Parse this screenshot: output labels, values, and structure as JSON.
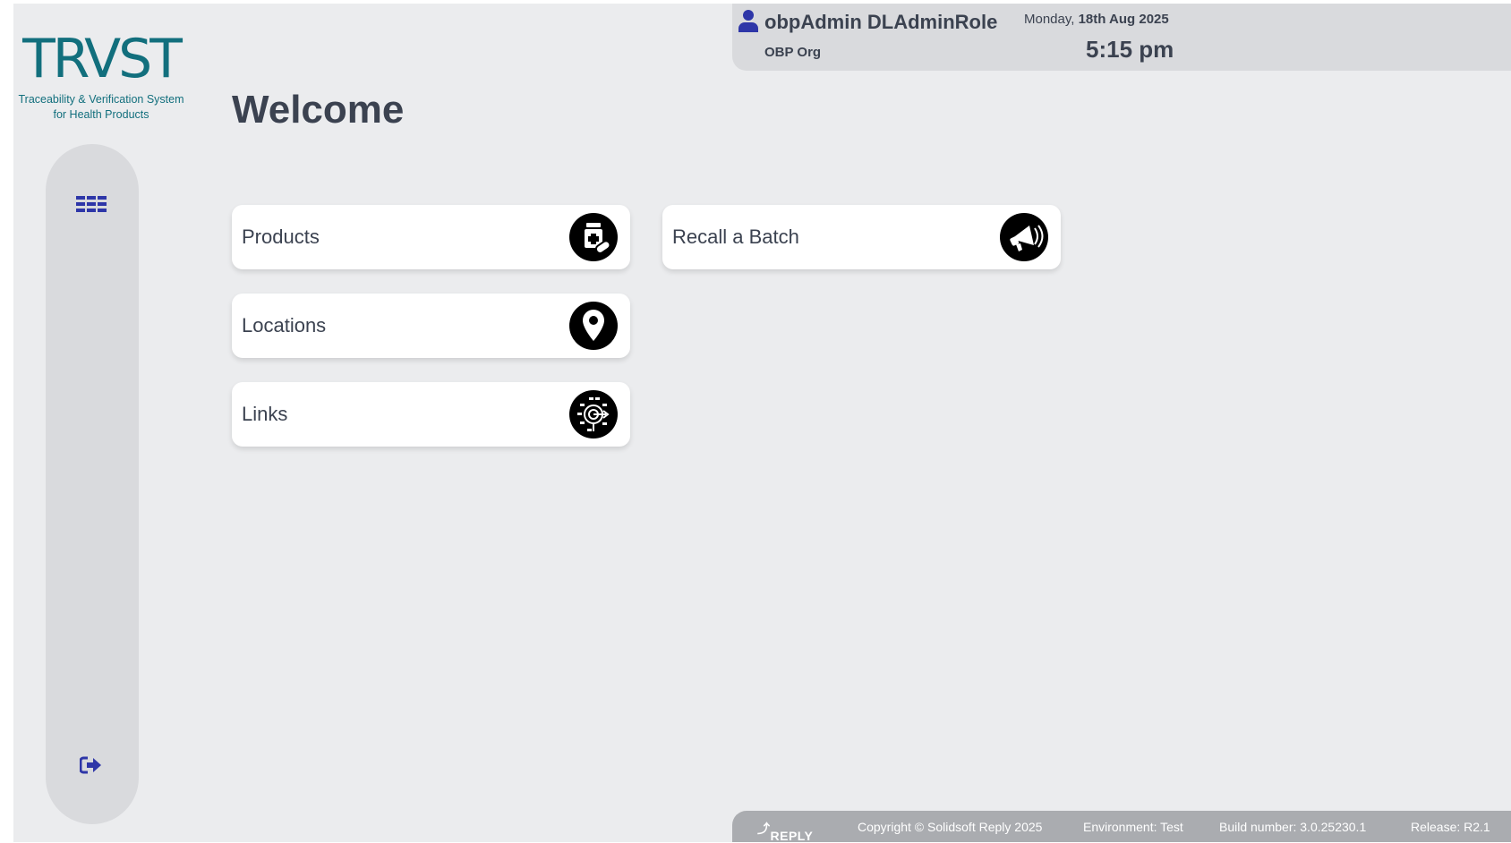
{
  "brand": {
    "logo_text": "TRVST",
    "tagline_line1": "Traceability & Verification System",
    "tagline_line2": "for Health Products"
  },
  "sidebar": {
    "menu_icon": "menu-icon",
    "logout_icon": "logout-icon"
  },
  "page_title": "Welcome",
  "user": {
    "name": "obpAdmin DLAdminRole",
    "org": "OBP Org",
    "icon": "user-icon"
  },
  "datetime": {
    "day": "Monday,",
    "date": "18th Aug 2025",
    "time": "5:15 pm"
  },
  "tiles": [
    {
      "label": "Products",
      "icon": "medicine-bottle-icon"
    },
    {
      "label": "Recall a Batch",
      "icon": "megaphone-icon"
    },
    {
      "label": "Locations",
      "icon": "location-pin-icon"
    },
    {
      "label": "Links",
      "icon": "network-links-icon"
    }
  ],
  "footer": {
    "logo": "REPLY",
    "copyright": "Copyright © Solidsoft Reply 2025",
    "environment": "Environment: Test",
    "build": "Build number: 3.0.25230.1",
    "release": "Release: R2.1"
  },
  "colors": {
    "background": "#ebecee",
    "panel": "#d9dadd",
    "accent_icon": "#2e36a8",
    "text": "#3b4250",
    "logo_teal": "#126f7d",
    "logo_green": "#3aa535",
    "footer": "#aaacb0"
  }
}
